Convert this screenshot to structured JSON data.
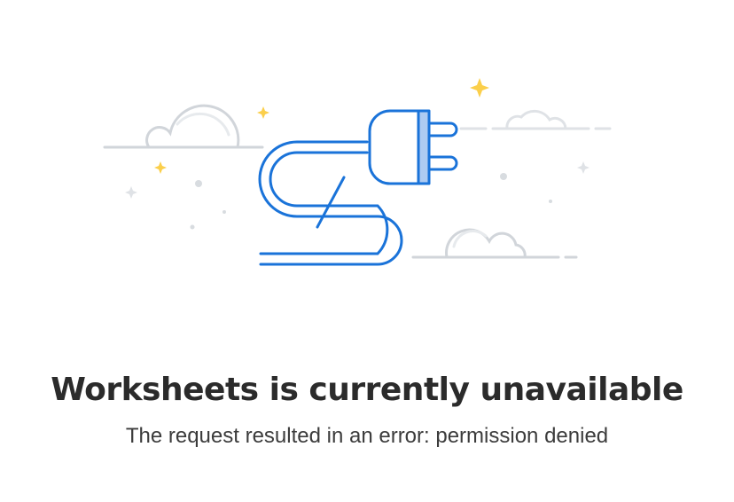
{
  "message": {
    "title": "Worksheets is currently unavailable",
    "subtitle": "The request resulted in an error: permission denied"
  },
  "illustration": {
    "icon": "unplugged-cable-icon",
    "colors": {
      "cable": "#1a73d9",
      "plug_accent": "#aecbf2",
      "cloud": "#d1d5da",
      "sparkle": "#fbcf4b",
      "dot": "#d8dce0"
    }
  }
}
